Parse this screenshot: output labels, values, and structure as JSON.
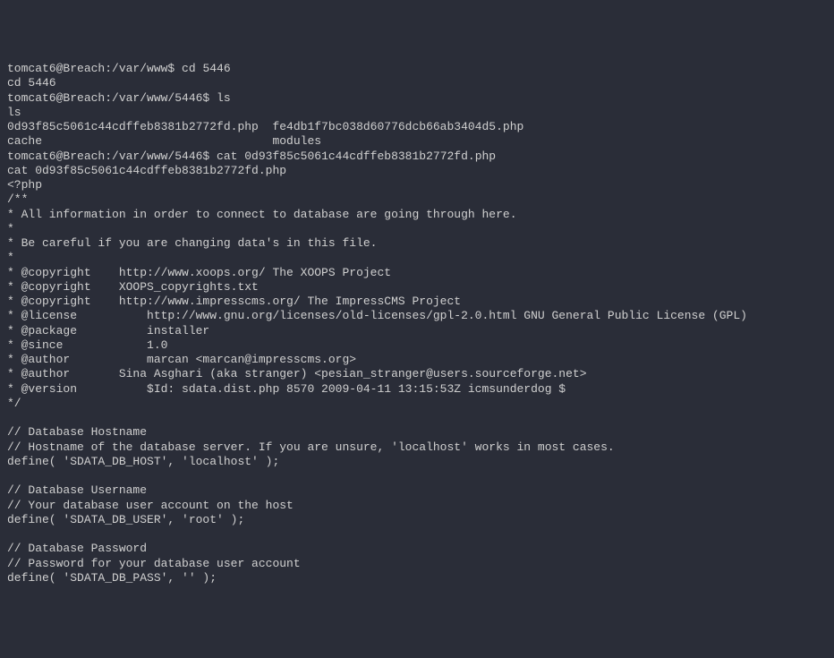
{
  "lines": [
    {
      "prompt": "tomcat6@Breach:/var/www$",
      "cmd": " cd 5446"
    },
    {
      "text": "cd 5446"
    },
    {
      "prompt": "tomcat6@Breach:/var/www/5446$",
      "cmd": " ls"
    },
    {
      "text": "ls"
    },
    {
      "text": "0d93f85c5061c44cdffeb8381b2772fd.php  fe4db1f7bc038d60776dcb66ab3404d5.php"
    },
    {
      "text": "cache                                 modules"
    },
    {
      "prompt": "tomcat6@Breach:/var/www/5446$",
      "cmd": " cat 0d93f85c5061c44cdffeb8381b2772fd.php"
    },
    {
      "text": "cat 0d93f85c5061c44cdffeb8381b2772fd.php"
    },
    {
      "text": "<?php"
    },
    {
      "text": "/**"
    },
    {
      "text": "* All information in order to connect to database are going through here."
    },
    {
      "text": "*"
    },
    {
      "text": "* Be careful if you are changing data's in this file."
    },
    {
      "text": "*"
    },
    {
      "text": "* @copyright    http://www.xoops.org/ The XOOPS Project"
    },
    {
      "text": "* @copyright    XOOPS_copyrights.txt"
    },
    {
      "text": "* @copyright    http://www.impresscms.org/ The ImpressCMS Project"
    },
    {
      "text": "* @license          http://www.gnu.org/licenses/old-licenses/gpl-2.0.html GNU General Public License (GPL)"
    },
    {
      "text": "* @package          installer"
    },
    {
      "text": "* @since            1.0"
    },
    {
      "text": "* @author           marcan <marcan@impresscms.org>"
    },
    {
      "text": "* @author       Sina Asghari (aka stranger) <pesian_stranger@users.sourceforge.net>"
    },
    {
      "text": "* @version          $Id: sdata.dist.php 8570 2009-04-11 13:15:53Z icmsunderdog $"
    },
    {
      "text": "*/"
    },
    {
      "text": ""
    },
    {
      "text": "// Database Hostname"
    },
    {
      "text": "// Hostname of the database server. If you are unsure, 'localhost' works in most cases."
    },
    {
      "text": "define( 'SDATA_DB_HOST', 'localhost' );"
    },
    {
      "text": ""
    },
    {
      "text": "// Database Username"
    },
    {
      "text": "// Your database user account on the host"
    },
    {
      "text": "define( 'SDATA_DB_USER', 'root' );"
    },
    {
      "text": ""
    },
    {
      "text": "// Database Password"
    },
    {
      "text": "// Password for your database user account"
    },
    {
      "text": "define( 'SDATA_DB_PASS', '' );"
    }
  ]
}
